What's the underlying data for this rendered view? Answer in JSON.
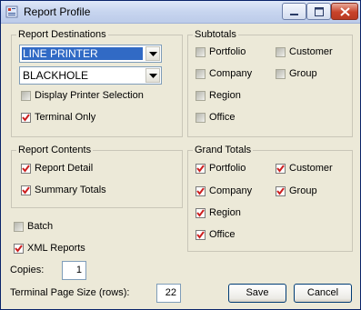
{
  "window": {
    "title": "Report Profile",
    "controls": {
      "minimize_icon": "minimize-icon",
      "maximize_icon": "maximize-icon",
      "close_icon": "close-icon"
    }
  },
  "report_destinations": {
    "legend": "Report Destinations",
    "printer_select": {
      "value": "LINE PRINTER"
    },
    "device_select": {
      "value": "BLACKHOLE"
    },
    "display_printer_selection": {
      "label": "Display Printer Selection",
      "checked": false
    },
    "terminal_only": {
      "label": "Terminal Only",
      "checked": true
    }
  },
  "subtotals": {
    "legend": "Subtotals",
    "items": [
      {
        "label": "Portfolio",
        "checked": false
      },
      {
        "label": "Customer",
        "checked": false
      },
      {
        "label": "Company",
        "checked": false
      },
      {
        "label": "Group",
        "checked": false
      },
      {
        "label": "Region",
        "checked": false
      },
      {
        "label": "Office",
        "checked": false
      }
    ]
  },
  "report_contents": {
    "legend": "Report Contents",
    "report_detail": {
      "label": "Report Detail",
      "checked": true
    },
    "summary_totals": {
      "label": "Summary Totals",
      "checked": true
    }
  },
  "grand_totals": {
    "legend": "Grand Totals",
    "items": [
      {
        "label": "Portfolio",
        "checked": true
      },
      {
        "label": "Customer",
        "checked": true
      },
      {
        "label": "Company",
        "checked": true
      },
      {
        "label": "Group",
        "checked": true
      },
      {
        "label": "Region",
        "checked": true
      },
      {
        "label": "Office",
        "checked": true
      }
    ]
  },
  "options": {
    "batch": {
      "label": "Batch",
      "checked": false
    },
    "xml_reports": {
      "label": "XML Reports",
      "checked": true
    }
  },
  "copies": {
    "label": "Copies:",
    "value": "1"
  },
  "page_size": {
    "label": "Terminal Page Size (rows):",
    "value": "22"
  },
  "buttons": {
    "save": "Save",
    "cancel": "Cancel"
  },
  "colors": {
    "selection": "#316ac5",
    "check_mark": "#cc1f1f",
    "dialog_bg": "#ece9d8"
  }
}
